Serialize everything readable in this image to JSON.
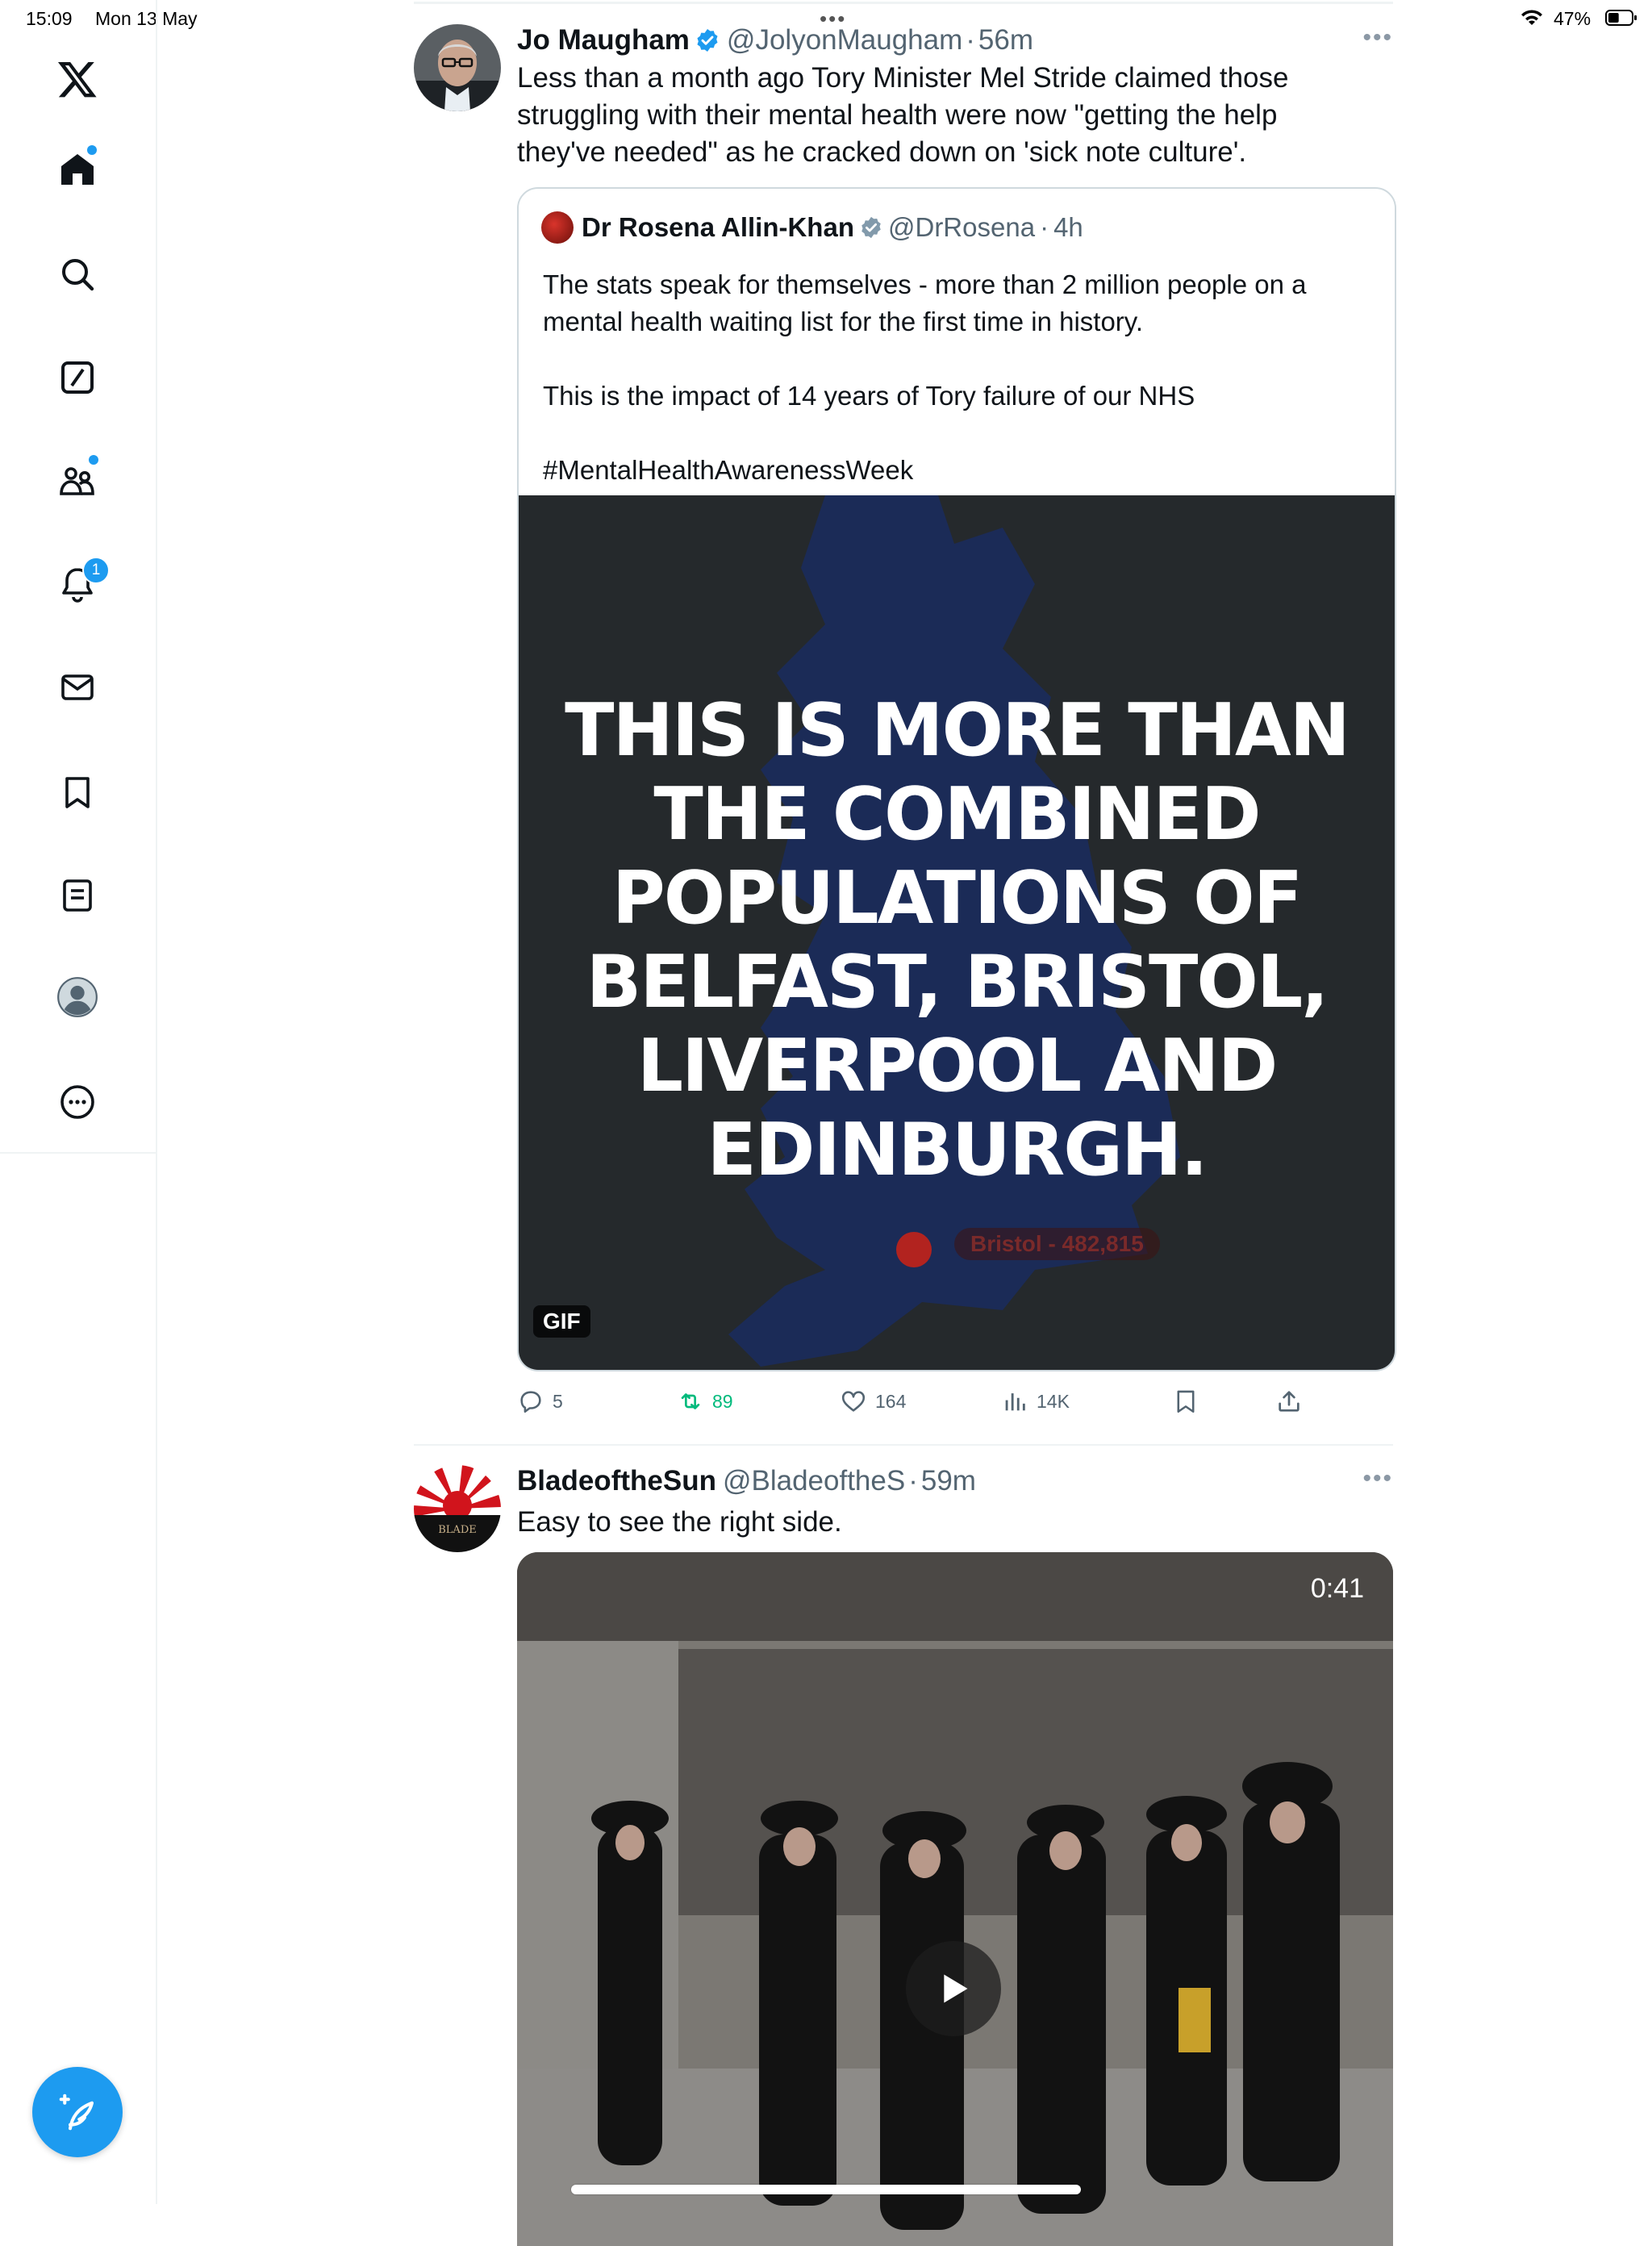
{
  "status_bar": {
    "time": "15:09",
    "date": "Mon 13 May",
    "battery_percent": "47%",
    "battery_level": 0.47
  },
  "sidebar": {
    "items": [
      {
        "name": "X",
        "icon": "x-logo-icon"
      },
      {
        "name": "Home",
        "icon": "home-icon",
        "has_dot": true
      },
      {
        "name": "Search",
        "icon": "search-icon"
      },
      {
        "name": "Grok",
        "icon": "grok-icon"
      },
      {
        "name": "Communities",
        "icon": "communities-icon",
        "has_dot": true
      },
      {
        "name": "Notifications",
        "icon": "bell-icon",
        "badge": "1"
      },
      {
        "name": "Messages",
        "icon": "mail-icon"
      },
      {
        "name": "Bookmarks",
        "icon": "bookmark-icon"
      },
      {
        "name": "Lists",
        "icon": "list-icon"
      },
      {
        "name": "Profile",
        "icon": "profile-icon"
      },
      {
        "name": "More",
        "icon": "more-circle-icon"
      }
    ],
    "compose_icon": "compose-icon",
    "accent_color": "#1d9bf0"
  },
  "tweets": [
    {
      "name": "Jo Maugham",
      "handle": "@JolyonMaugham",
      "time": "56m",
      "verified": true,
      "text": "Less than a month ago Tory Minister Mel Stride claimed those struggling with their mental health were now \"getting the help they've needed\" as he cracked down on 'sick note culture'.",
      "quote": {
        "name": "Dr Rosena Allin-Khan",
        "handle": "@DrRosena",
        "time": "4h",
        "verified_color": "#829aab",
        "text": "The stats speak for themselves - more than 2 million people on a mental health waiting list for the first time in history.\n\nThis is the impact of 14 years of Tory failure of our NHS\n\n#MentalHealthAwarenessWeek",
        "media_caption": "THIS IS MORE THAN THE COMBINED POPULATIONS OF BELFAST, BRISTOL, LIVERPOOL AND EDINBURGH.",
        "media_map_label": "Bristol - 482,815",
        "media_badge": "GIF"
      },
      "stats": {
        "replies": "5",
        "reposts": "89",
        "likes": "164",
        "views": "14K"
      },
      "repost_color": "#00ba7c"
    },
    {
      "name": "BladeoftheSun",
      "handle": "@BladeoftheS",
      "time": "59m",
      "text": "Easy to see the right side.",
      "video_duration": "0:41"
    }
  ]
}
